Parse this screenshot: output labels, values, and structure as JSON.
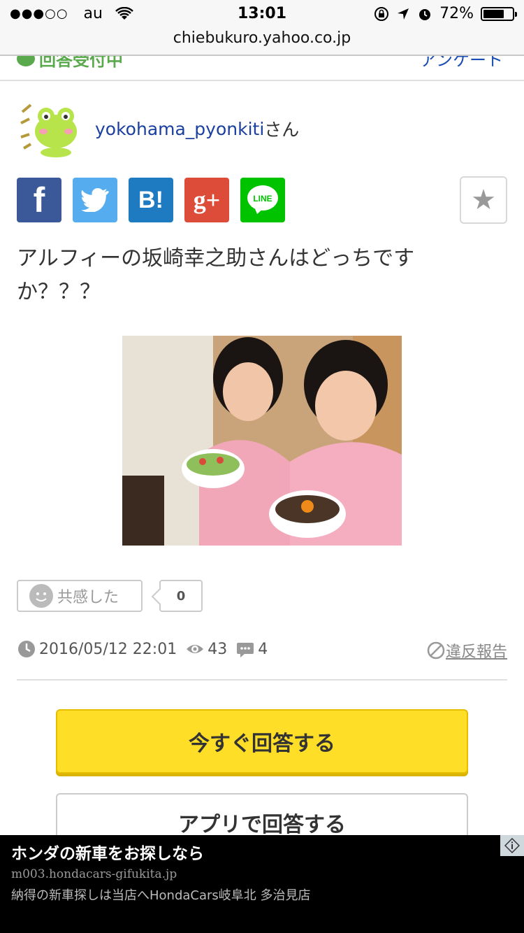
{
  "status": {
    "carrier": "au",
    "time": "13:01",
    "battery": "72%",
    "battery_level": 0.72
  },
  "url": "chiebukuro.yahoo.co.jp",
  "top_row": {
    "left": "回答受付中",
    "right": "アンケート"
  },
  "user": {
    "name": "yokohama_pyonkiti",
    "suffix": "さん"
  },
  "share": {
    "facebook": "f",
    "twitter": "twitter",
    "hatena": "B!",
    "google": "g+",
    "line": "LINE",
    "favorite": "★"
  },
  "question": "アルフィーの坂崎幸之助さんはどっちですか？？？",
  "empathy": {
    "label": "共感した",
    "count": "0"
  },
  "meta": {
    "date": "2016/05/12 22:01",
    "views": "43",
    "answers": "4",
    "report": "違反報告"
  },
  "buttons": {
    "answer_now": "今すぐ回答する",
    "answer_app": "アプリで回答する"
  },
  "ad": {
    "title": "ホンダの新車をお探しなら",
    "url": "m003.hondacars-gifukita.jp",
    "desc": "納得の新車探しは当店へHondaCars岐阜北 多治見店"
  },
  "colors": {
    "link": "#1a3fa0",
    "answer_button": "#ffde28",
    "facebook": "#3b5998",
    "twitter": "#55acee",
    "hatena": "#1f7bc1",
    "google": "#dd4b39",
    "line": "#00c300"
  }
}
